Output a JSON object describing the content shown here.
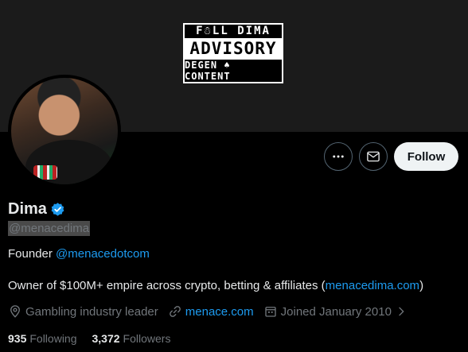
{
  "banner": {
    "advisory_top": "F☃LL DIMA",
    "advisory_middle": "ADVISORY",
    "advisory_bottom": "DEGEN ♠ CONTENT"
  },
  "actions": {
    "more_icon": "more-horizontal-icon",
    "message_icon": "envelope-icon",
    "follow_label": "Follow"
  },
  "profile": {
    "name": "Dima",
    "verified": true,
    "handle": "@menacedima",
    "bio_line1_prefix": "Founder ",
    "bio_line1_link": "@menacedotcom",
    "bio_line2_prefix": "Owner of $100M+ empire across crypto, betting & affiliates (",
    "bio_line2_link": "menacedima.com",
    "bio_line2_suffix": ")",
    "location": "Gambling industry leader",
    "website": "menace.com",
    "joined": "Joined January 2010"
  },
  "stats": {
    "following_count": "935",
    "following_label": "Following",
    "followers_count": "3,372",
    "followers_label": "Followers"
  },
  "colors": {
    "accent": "#1d9bf0",
    "background": "#000000",
    "text": "#e7e9ea",
    "secondary_text": "#71767b"
  }
}
